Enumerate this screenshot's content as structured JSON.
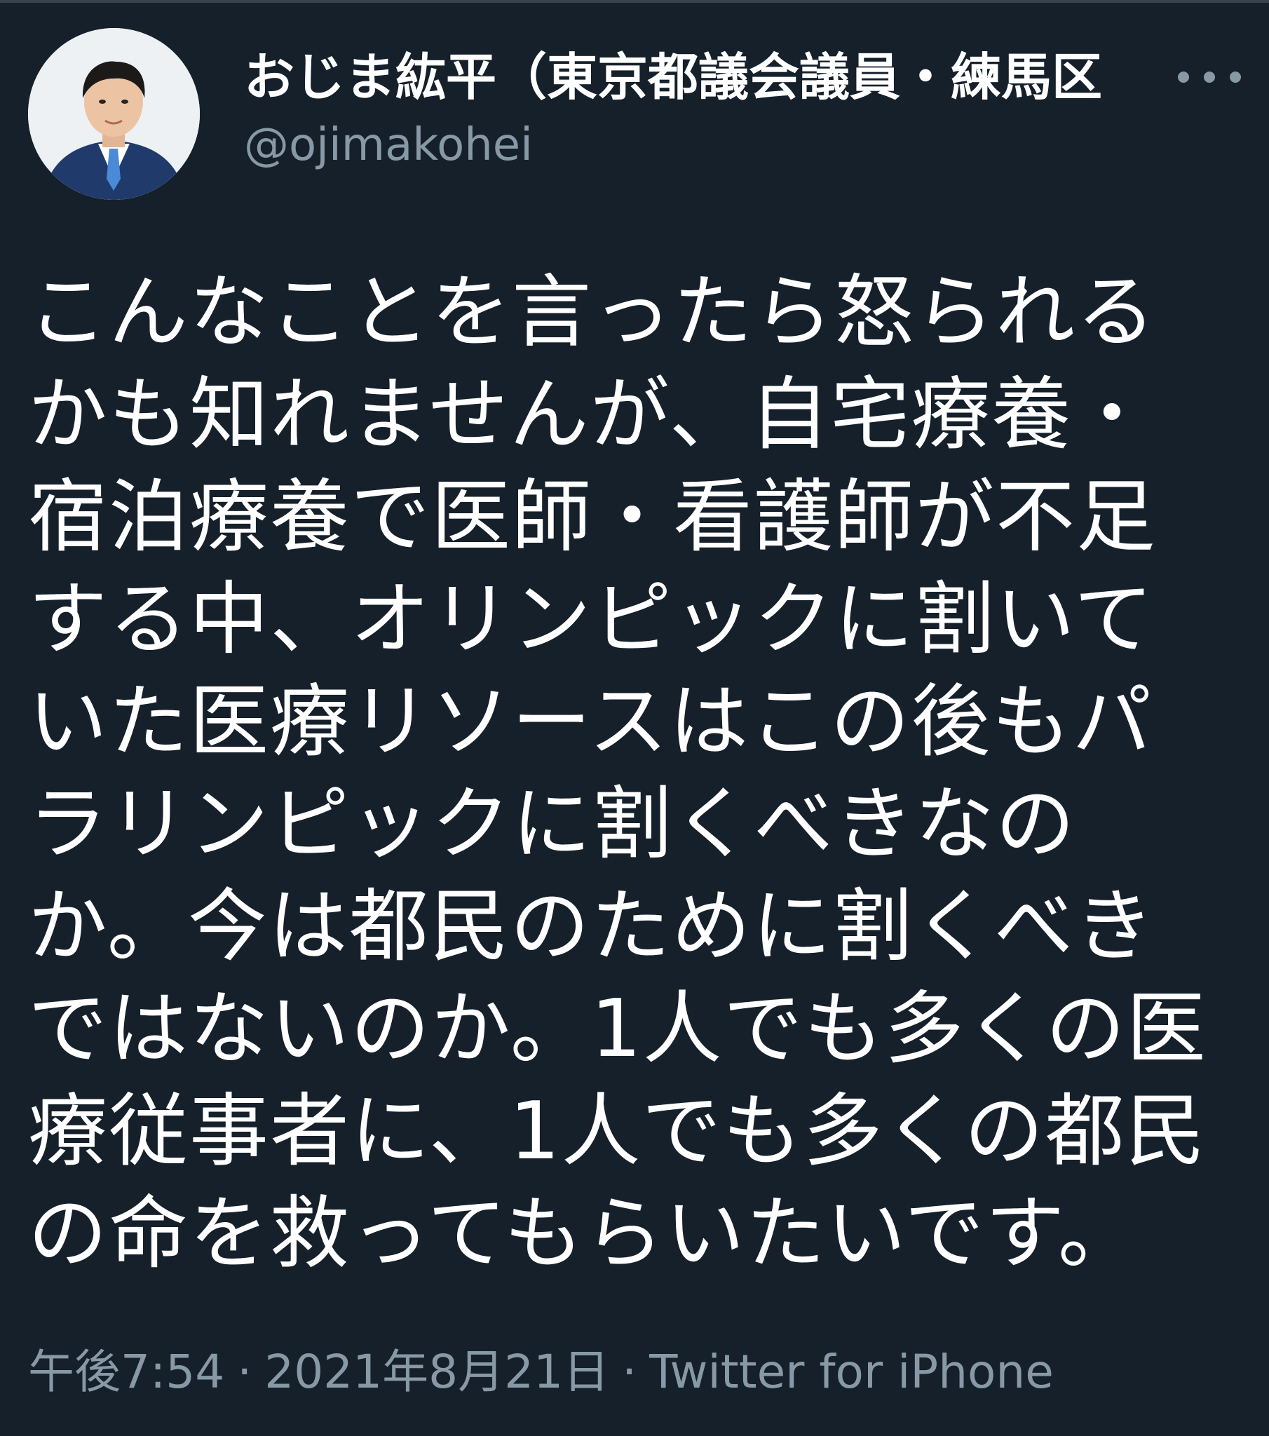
{
  "user": {
    "display_name": "おじま紘平（東京都議会議員・練馬区",
    "handle": "@ojimakohei",
    "avatar": "profile-photo"
  },
  "more_icon": "more-horizontal-icon",
  "tweet": {
    "lines": [
      "こんなことを言ったら怒られる",
      "かも知れませんが、自宅療養・",
      "宿泊療養で医師・看護師が不足",
      "する中、オリンピックに割いて",
      "いた医療リソースはこの後もパ",
      "ラリンピックに割くべきなの",
      "か。今は都民のために割くべき",
      "ではないのか。1人でも多くの医",
      "療従事者に、1人でも多くの都民",
      "の命を救ってもらいたいです。"
    ]
  },
  "meta": {
    "time": "午後7:54",
    "separator": "·",
    "date": "2021年8月21日",
    "source": "Twitter for iPhone"
  },
  "colors": {
    "background": "#15202b",
    "text": "#ffffff",
    "secondary": "#8899a6"
  }
}
